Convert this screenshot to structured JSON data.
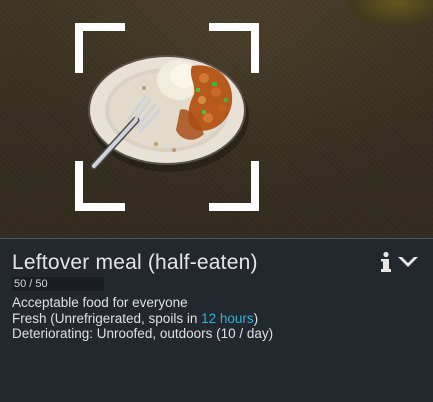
{
  "item": {
    "name": "Leftover meal (half-eaten)",
    "hp_text": "50 / 50",
    "hp_fraction": 1.0,
    "description": "Acceptable food for everyone",
    "freshness": {
      "prefix": "Fresh (Unrefrigerated, spoils in ",
      "time": "12 hours",
      "suffix": ")"
    },
    "deterioration": "Deteriorating: Unroofed, outdoors (10 / day)"
  },
  "icons": {
    "info": "info-icon",
    "collapse": "collapse-down-icon",
    "selection": "selection-brackets"
  },
  "colors": {
    "highlight": "#2fb1da",
    "panel_bg": "#23272e",
    "text": "#e0e0e0"
  }
}
